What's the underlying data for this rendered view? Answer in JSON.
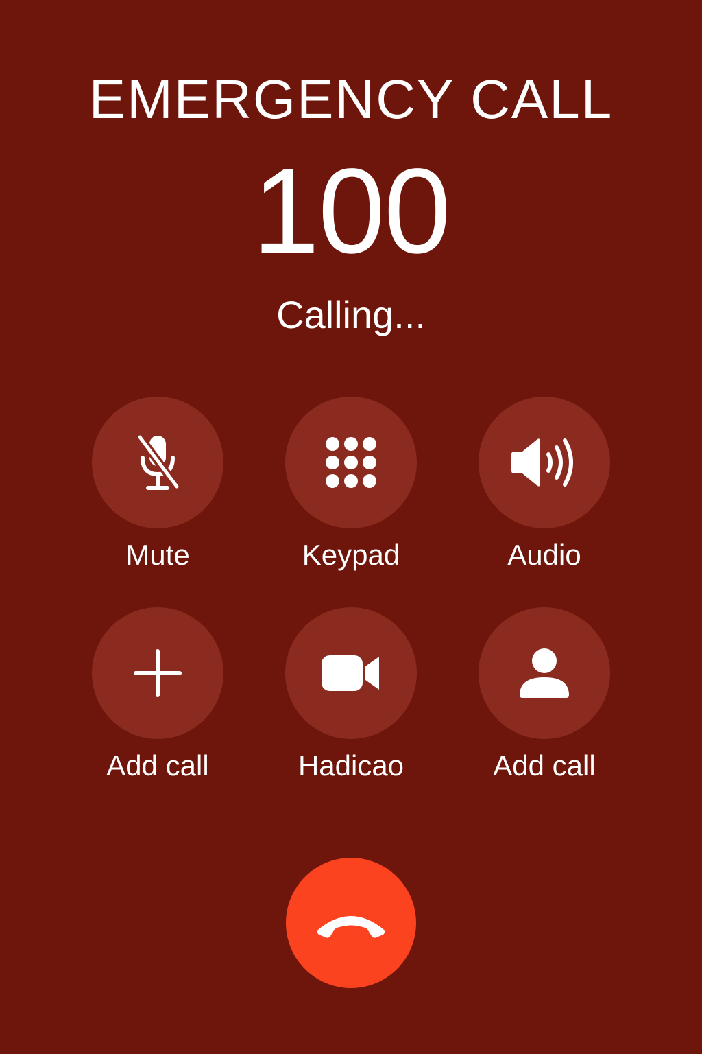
{
  "header": {
    "title": "EMERGENCY CALL",
    "number": "100",
    "status": "Calling..."
  },
  "controls": [
    {
      "label": "Mute",
      "icon": "microphone-off-icon"
    },
    {
      "label": "Keypad",
      "icon": "keypad-icon"
    },
    {
      "label": "Audio",
      "icon": "speaker-icon"
    },
    {
      "label": "Add call",
      "icon": "plus-icon"
    },
    {
      "label": "Hadicao",
      "icon": "video-camera-icon"
    },
    {
      "label": "Add call",
      "icon": "person-icon"
    }
  ],
  "end_call": {
    "icon": "end-call-icon"
  },
  "colors": {
    "background": "#6e160b",
    "button": "#8b2a1e",
    "end_call": "#fb4320",
    "text": "#ffffff"
  }
}
